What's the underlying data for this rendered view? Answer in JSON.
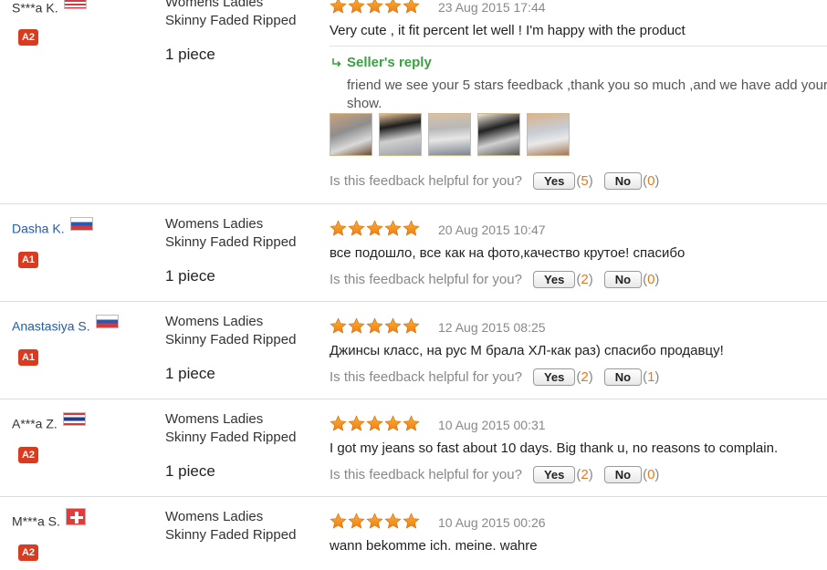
{
  "helpful_prompt": "Is this feedback helpful for you?",
  "yes_label": "Yes",
  "no_label": "No",
  "colors": {
    "link": "#1f5ea8",
    "badge": "#d83b1f",
    "star": "#f39c12",
    "reply": "#3aa043",
    "count": "#e07b1a"
  },
  "reviews": [
    {
      "buyer": "S***a K.",
      "country_flag": "us-flag-icon",
      "level": "A2",
      "product_line1": "Womens Ladies",
      "product_line2": "Skinny Faded Ripped",
      "quantity": "1 piece",
      "stars": 5,
      "date": "23 Aug 2015 17:44",
      "comment": "Very cute , it fit percent let well ! I'm happy with the product",
      "seller_reply": {
        "label": "Seller's reply",
        "text": "friend we see your 5 stars feedback ,thank you so much ,and we have add your show.",
        "photo_count": 5
      },
      "yes_count": "5",
      "no_count": "0"
    },
    {
      "buyer": "Dasha K.",
      "country_flag": "ru-flag-icon",
      "level": "A1",
      "product_line1": "Womens Ladies",
      "product_line2": "Skinny Faded Ripped",
      "quantity": "1 piece",
      "stars": 5,
      "date": "20 Aug 2015 10:47",
      "comment": "все подошло, все как на фото,качество крутое! спасибо",
      "yes_count": "2",
      "no_count": "0"
    },
    {
      "buyer": "Anastasiya S.",
      "country_flag": "ru-flag-icon",
      "level": "A1",
      "product_line1": "Womens Ladies",
      "product_line2": "Skinny Faded Ripped",
      "quantity": "1 piece",
      "stars": 5,
      "date": "12 Aug 2015 08:25",
      "comment": "Джинсы класс, на рус М брала ХЛ-как раз) спасибо продавцу!",
      "yes_count": "2",
      "no_count": "1"
    },
    {
      "buyer": "A***a Z.",
      "country_flag": "th-flag-icon",
      "level": "A2",
      "product_line1": "Womens Ladies",
      "product_line2": "Skinny Faded Ripped",
      "quantity": "1 piece",
      "stars": 5,
      "date": "10 Aug 2015 00:31",
      "comment": "I got my jeans so fast about 10 days. Big thank u, no reasons to complain.",
      "yes_count": "2",
      "no_count": "0"
    },
    {
      "buyer": "M***a S.",
      "country_flag": "ch-flag-icon",
      "level": "A2",
      "product_line1": "Womens Ladies",
      "product_line2": "Skinny Faded Ripped",
      "stars": 5,
      "date": "10 Aug 2015 00:26",
      "comment": "wann bekomme ich. meine. wahre"
    }
  ]
}
